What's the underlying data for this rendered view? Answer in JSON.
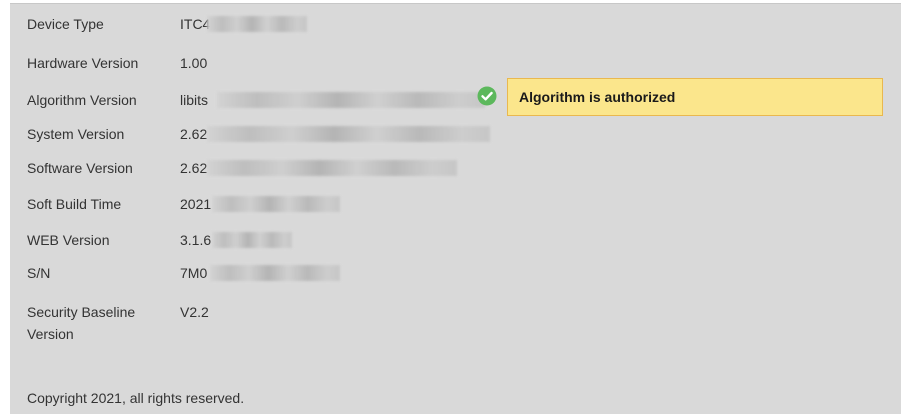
{
  "device_info": {
    "rows": [
      {
        "label": "Device Type",
        "value": "ITC4"
      },
      {
        "label": "Hardware Version",
        "value": "1.00"
      },
      {
        "label": "Algorithm Version",
        "value": "libits"
      },
      {
        "label": "System Version",
        "value": "2.62"
      },
      {
        "label": "Software Version",
        "value": "2.62"
      },
      {
        "label": "Soft Build Time",
        "value": "2021"
      },
      {
        "label": "WEB Version",
        "value": "3.1.6"
      },
      {
        "label": "S/N",
        "value": "7M0"
      },
      {
        "label": "Security Baseline",
        "label_line2": "Version",
        "value": "V2.2"
      }
    ],
    "algorithm_status": "Algorithm is authorized",
    "copyright": "Copyright 2021, all rights reserved."
  },
  "colors": {
    "panel_background": "#d9d9d9",
    "status_background": "#fbe68c",
    "status_border": "#e9b84f",
    "check_green": "#5cb85c"
  },
  "icons": {
    "authorized_check": "check-circle-icon"
  }
}
